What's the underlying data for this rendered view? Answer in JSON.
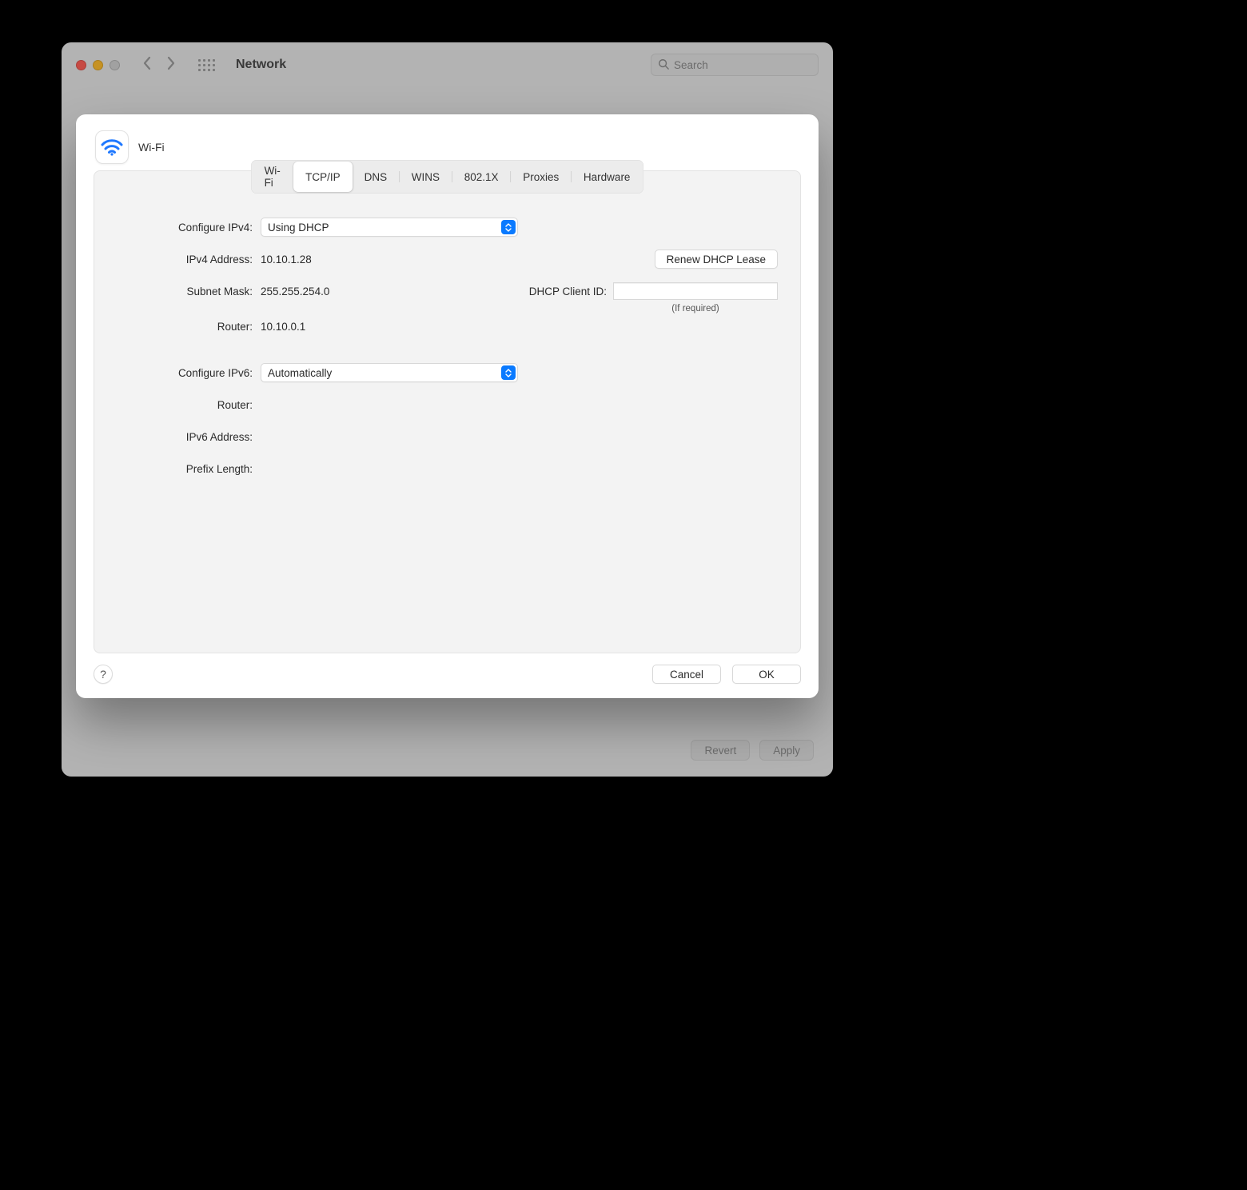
{
  "parent": {
    "title": "Network",
    "search_placeholder": "Search",
    "revert_label": "Revert",
    "apply_label": "Apply"
  },
  "sheet": {
    "interface_name": "Wi-Fi",
    "tabs": [
      "Wi-Fi",
      "TCP/IP",
      "DNS",
      "WINS",
      "802.1X",
      "Proxies",
      "Hardware"
    ],
    "selected_tab_index": 1,
    "labels": {
      "configure_ipv4": "Configure IPv4:",
      "ipv4_address": "IPv4 Address:",
      "subnet_mask": "Subnet Mask:",
      "router": "Router:",
      "configure_ipv6": "Configure IPv6:",
      "router6": "Router:",
      "ipv6_address": "IPv6 Address:",
      "prefix_length": "Prefix Length:",
      "dhcp_client_id": "DHCP Client ID:"
    },
    "values": {
      "configure_ipv4": "Using DHCP",
      "ipv4_address": "10.10.1.28",
      "subnet_mask": "255.255.254.0",
      "router": "10.10.0.1",
      "configure_ipv6": "Automatically",
      "router6": "",
      "ipv6_address": "",
      "prefix_length": "",
      "dhcp_client_id": ""
    },
    "hints": {
      "dhcp_client_id": "(If required)"
    },
    "buttons": {
      "renew_dhcp": "Renew DHCP Lease",
      "cancel": "Cancel",
      "ok": "OK",
      "help": "?"
    }
  }
}
